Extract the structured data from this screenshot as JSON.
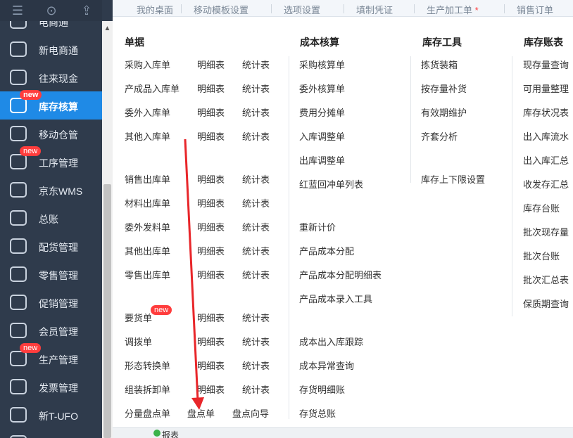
{
  "sidebar": {
    "top_icons": [
      "menu-icon",
      "search-icon",
      "export-icon"
    ],
    "items": [
      {
        "label": "电商通",
        "icon": "shop-icon",
        "badge": ""
      },
      {
        "label": "新电商通",
        "icon": "e-commerce-icon",
        "badge": ""
      },
      {
        "label": "往来现金",
        "icon": "cash-transfer-icon",
        "badge": ""
      },
      {
        "label": "库存核算",
        "icon": "inventory-icon",
        "badge": "new"
      },
      {
        "label": "移动仓管",
        "icon": "mobile-warehouse-icon",
        "badge": ""
      },
      {
        "label": "工序管理",
        "icon": "process-icon",
        "badge": "new"
      },
      {
        "label": "京东WMS",
        "icon": "truck-icon",
        "badge": ""
      },
      {
        "label": "总账",
        "icon": "ledger-icon",
        "badge": ""
      },
      {
        "label": "配货管理",
        "icon": "distribution-icon",
        "badge": ""
      },
      {
        "label": "零售管理",
        "icon": "retail-icon",
        "badge": ""
      },
      {
        "label": "促销管理",
        "icon": "megaphone-icon",
        "badge": ""
      },
      {
        "label": "会员管理",
        "icon": "member-icon",
        "badge": ""
      },
      {
        "label": "生产管理",
        "icon": "production-icon",
        "badge": "new"
      },
      {
        "label": "发票管理",
        "icon": "invoice-icon",
        "badge": ""
      },
      {
        "label": "新T-UFO",
        "icon": "report-building-icon",
        "badge": ""
      },
      {
        "label": "",
        "icon": "more-icon",
        "badge": ""
      }
    ]
  },
  "tabs": [
    {
      "label": "我的桌面",
      "required": false
    },
    {
      "label": "移动模板设置",
      "required": false
    },
    {
      "label": "选项设置",
      "required": false
    },
    {
      "label": "填制凭证",
      "required": false
    },
    {
      "label": "生产加工单",
      "required": true,
      "required_mark": "*"
    },
    {
      "label": "销售订单",
      "required": false
    }
  ],
  "columns": {
    "documents": {
      "header": "单据",
      "groups": [
        [
          [
            "采购入库单",
            "明细表",
            "统计表"
          ],
          [
            "产成品入库单",
            "明细表",
            "统计表"
          ],
          [
            "委外入库单",
            "明细表",
            "统计表"
          ],
          [
            "其他入库单",
            "明细表",
            "统计表"
          ]
        ],
        [
          [
            "销售出库单",
            "明细表",
            "统计表"
          ],
          [
            "材料出库单",
            "明细表",
            "统计表"
          ],
          [
            "委外发料单",
            "明细表",
            "统计表"
          ],
          [
            "其他出库单",
            "明细表",
            "统计表"
          ],
          [
            "零售出库单",
            "明细表",
            "统计表"
          ]
        ],
        [
          [
            "要货单",
            "明细表",
            "统计表"
          ],
          [
            "调拨单",
            "明细表",
            "统计表"
          ],
          [
            "形态转换单",
            "明细表",
            "统计表"
          ],
          [
            "组装拆卸单",
            "明细表",
            "统计表"
          ],
          [
            "分量盘点单",
            "盘点单",
            "盘点向导"
          ]
        ]
      ],
      "new_badge": "new"
    },
    "cost": {
      "header": "成本核算",
      "groups": [
        [
          "采购核算单",
          "委外核算单",
          "费用分摊单",
          "入库调整单",
          "出库调整单",
          "红蓝回冲单列表"
        ],
        [
          "重新计价",
          "产品成本分配",
          "产品成本分配明细表",
          "产品成本录入工具"
        ],
        [
          "成本出入库跟踪",
          "成本异常查询",
          "存货明细账",
          "存货总账"
        ]
      ]
    },
    "tools": {
      "header": "库存工具",
      "items": [
        "拣货装箱",
        "按存量补货",
        "有效期维护",
        "齐套分析"
      ],
      "items2": [
        "库存上下限设置"
      ]
    },
    "ledger": {
      "header": "库存账表",
      "items": [
        "现存量查询",
        "可用量整理",
        "库存状况表",
        "出入库流水",
        "出入库汇总",
        "收发存汇总",
        "库存台账",
        "批次现存量",
        "批次台账",
        "批次汇总表",
        "保质期查询"
      ]
    }
  },
  "bottom": {
    "label": "报表"
  },
  "colors": {
    "sidebar_bg": "#2f3b4c",
    "active": "#1f8ae6",
    "badge": "#ff3d3d",
    "arrow": "#e8262a"
  }
}
